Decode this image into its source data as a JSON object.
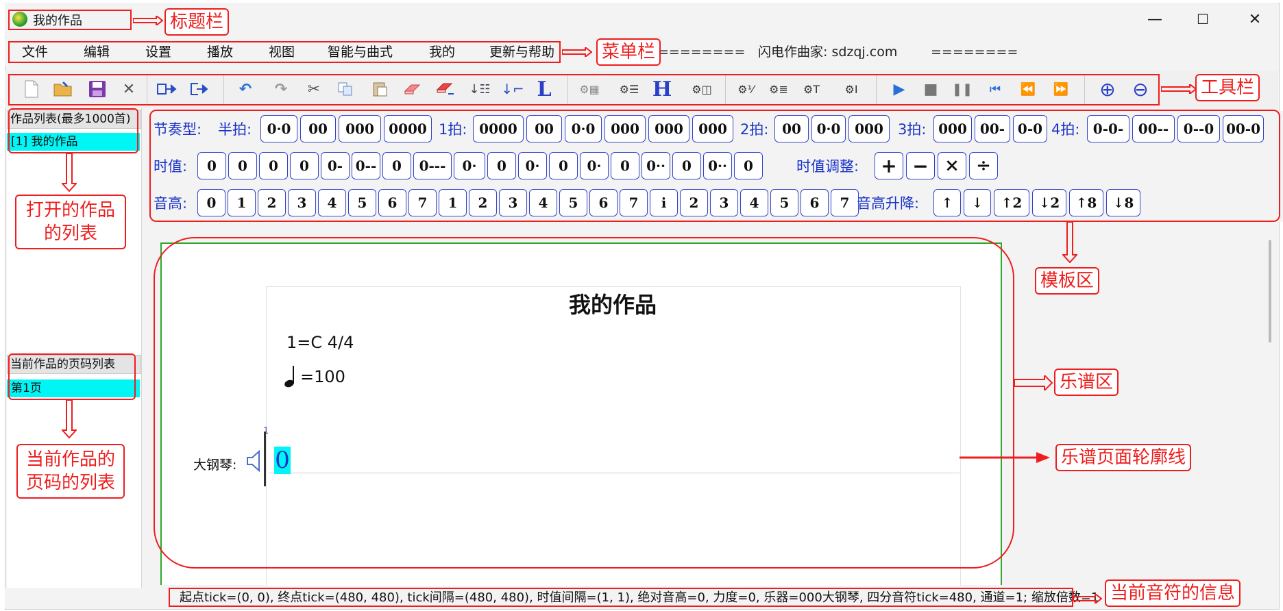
{
  "window": {
    "title": "我的作品",
    "controls": [
      "—",
      "☐",
      "✕"
    ]
  },
  "menu": {
    "items": [
      "文件",
      "编辑",
      "设置",
      "播放",
      "视图",
      "智能与曲式",
      "我的",
      "更新与帮助"
    ],
    "deco_left": "========",
    "site": "闪电作曲家: sdzqj.com",
    "deco_right": "========"
  },
  "toolbar": {
    "icons": [
      "new-file",
      "open-folder",
      "save",
      "close",
      "export",
      "export-arrow",
      "undo",
      "redo",
      "cut",
      "copy",
      "paste",
      "eraser",
      "eraser-red",
      "insert-below",
      "insert-left",
      "bold-L",
      "setting-grid",
      "setting-lines",
      "bold-H",
      "setting-box",
      "setting-frac",
      "setting-lines2",
      "setting-T",
      "setting-I",
      "play",
      "stop",
      "pause",
      "to-start",
      "rewind",
      "fast-forward",
      "zoom-in",
      "zoom-out"
    ],
    "h_label": "H",
    "l_label": "L"
  },
  "sidebar": {
    "works_header": "作品列表(最多1000首)",
    "works": [
      "[1] 我的作品"
    ],
    "pages_header": "当前作品的页码列表",
    "pages": [
      "第1页"
    ]
  },
  "template": {
    "rhythm_label": "节奏型:",
    "half_label": "半拍:",
    "half_keys": [
      "0·0",
      "00",
      "000",
      "0000"
    ],
    "one_label": "1拍:",
    "one_keys": [
      "0000",
      "00",
      "0·0",
      "000",
      "000",
      "000"
    ],
    "two_label": "2拍:",
    "two_keys": [
      "00",
      "0·0",
      "000"
    ],
    "three_label": "3拍:",
    "three_keys": [
      "000",
      "00-",
      "0-0"
    ],
    "four_label": "4拍:",
    "four_keys": [
      "0-0-",
      "00--",
      "0--0",
      "00-0"
    ],
    "duration_label": "时值:",
    "duration_keys": [
      "0",
      "0",
      "0",
      "0",
      "0-",
      "0--",
      "0",
      "0---",
      "0·",
      "0",
      "0·",
      "0",
      "0·",
      "0",
      "0··",
      "0",
      "0··",
      "0"
    ],
    "adjust_label": "时值调整:",
    "adjust_keys": [
      "+",
      "−",
      "×",
      "÷"
    ],
    "pitch_label": "音高:",
    "pitch_keys": [
      "0",
      "1",
      "2",
      "3",
      "4",
      "5",
      "6",
      "7",
      "1",
      "2",
      "3",
      "4",
      "5",
      "6",
      "7",
      "i",
      "2",
      "3",
      "4",
      "5",
      "6",
      "7"
    ],
    "shift_label": "音高升降:",
    "shift_keys": [
      "↑",
      "↓",
      "↑2",
      "↓2",
      "↑8",
      "↓8"
    ]
  },
  "score": {
    "title": "我的作品",
    "key": "1=C 4/4",
    "tempo": "=100",
    "measure_number": "1",
    "instrument": "大钢琴:",
    "note": "0"
  },
  "status": {
    "text": "起点tick=(0, 0), 终点tick=(480, 480), tick间隔=(480, 480), 时值间隔=(1, 1), 绝对音高=0, 力度=0, 乐器=000大钢琴, 四分音符tick=480, 通道=1; 缩放倍数=1"
  },
  "annotations": {
    "titlebar": "标题栏",
    "menubar": "菜单栏",
    "toolbar": "工具栏",
    "open_works": "打开的作品\n的列表",
    "pages_list": "当前作品的\n页码的列表",
    "template_area": "模板区",
    "score_area": "乐谱区",
    "page_outline": "乐谱页面轮廓线",
    "note_info": "当前音符的信息"
  },
  "colors": {
    "annotation_red": "#ef1d1d",
    "key_border_blue": "#3344cc",
    "label_blue": "#1a34c8",
    "selection_cyan": "#00f5f5",
    "page_outline_green": "#2fa52f"
  }
}
